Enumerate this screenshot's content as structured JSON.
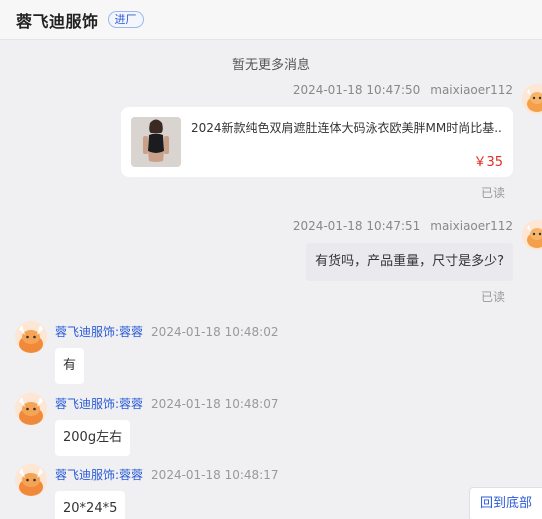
{
  "header": {
    "shop_name": "蓉飞迪服饰",
    "tag": "进厂"
  },
  "no_more": "暂无更多消息",
  "messages": {
    "m1": {
      "timestamp": "2024-01-18 10:47:50",
      "user": "maixiaoer112",
      "product_title": "2024新款纯色双肩遮肚连体大码泳衣欧美胖MM时尚比基...",
      "price": "￥35",
      "read": "已读"
    },
    "m2": {
      "timestamp": "2024-01-18 10:47:51",
      "user": "maixiaoer112",
      "text": "有货吗，产品重量，尺寸是多少?",
      "read": "已读"
    },
    "m3": {
      "sender": "蓉飞迪服饰:蓉蓉",
      "timestamp": "2024-01-18 10:48:02",
      "text": "有"
    },
    "m4": {
      "sender": "蓉飞迪服饰:蓉蓉",
      "timestamp": "2024-01-18 10:48:07",
      "text": "200g左右"
    },
    "m5": {
      "sender": "蓉飞迪服饰:蓉蓉",
      "timestamp": "2024-01-18 10:48:17",
      "text": "20*24*5"
    }
  },
  "scroll_bottom_label": "回到底部",
  "icons": {
    "avatar_shop": "cartoon-bull-avatar-icon",
    "chevron": "chevron-down-icon"
  },
  "colors": {
    "accent": "#2a5bd7",
    "price": "#e02e24",
    "background": "#f0f0f2"
  }
}
